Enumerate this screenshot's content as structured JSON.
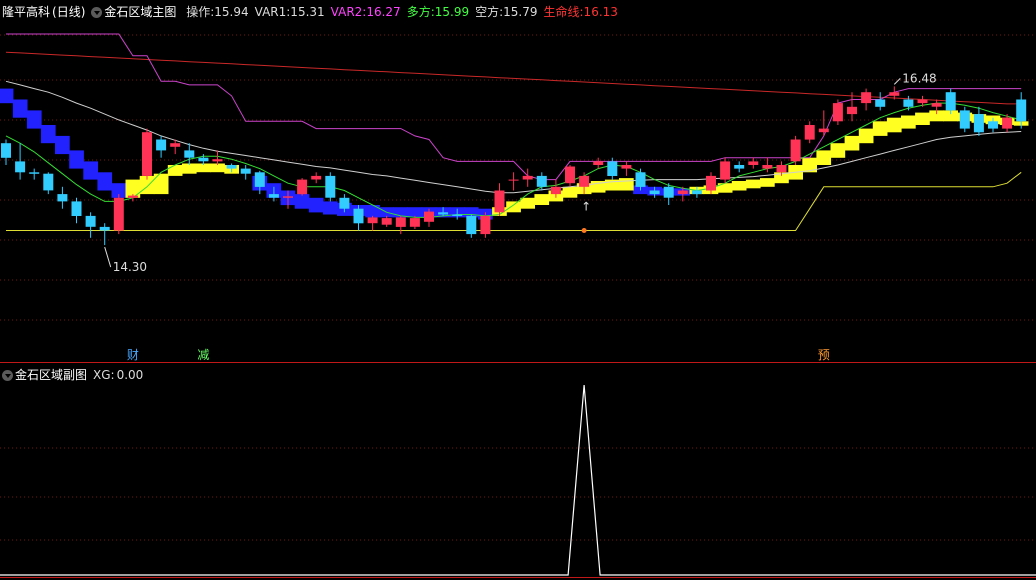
{
  "header": {
    "stock_name": "隆平高科",
    "period": "(日线)",
    "indicator": "金石区域主图",
    "fields": [
      {
        "label": "操作:",
        "value": "15.94",
        "color": "#dcdcdc"
      },
      {
        "label": "VAR1:",
        "value": "15.31",
        "color": "#dcdcdc"
      },
      {
        "label": "VAR2:",
        "value": "16.27",
        "color": "#ff44ff"
      },
      {
        "label": "多方:",
        "value": "15.99",
        "color": "#44ff44"
      },
      {
        "label": "空方:",
        "value": "15.79",
        "color": "#dcdcdc"
      },
      {
        "label": "生命线:",
        "value": "16.13",
        "color": "#ff3333"
      }
    ]
  },
  "sub_header": {
    "indicator": "金石区域副图",
    "label": "XG:",
    "value": "0.00"
  },
  "annotations": {
    "high_label": "16.48",
    "low_label": "14.30",
    "arrow": "↑"
  },
  "signals": [
    {
      "text": "财",
      "bar": 9,
      "color": "#4aa8ff"
    },
    {
      "text": "减",
      "bar": 14,
      "color": "#66ff66"
    },
    {
      "text": "预",
      "bar": 58,
      "color": "#ff9933"
    }
  ],
  "colors": {
    "up": "#ff3355",
    "down": "#33ccff",
    "kong_band": "#2222ff",
    "duo_band": "#ffff22",
    "life_line": "#c82828",
    "var2_line": "#cc44cc",
    "grid": "#7a1414",
    "sub_line": "#ffffff"
  },
  "chart_data": {
    "type": "candlestick",
    "y_range": [
      13.6,
      17.2
    ],
    "ohlc": [
      [
        15.7,
        15.75,
        15.4,
        15.5
      ],
      [
        15.45,
        15.7,
        15.2,
        15.3
      ],
      [
        15.3,
        15.35,
        15.2,
        15.28
      ],
      [
        15.28,
        15.3,
        15.0,
        15.05
      ],
      [
        15.0,
        15.1,
        14.8,
        14.9
      ],
      [
        14.9,
        14.95,
        14.6,
        14.7
      ],
      [
        14.7,
        14.75,
        14.4,
        14.55
      ],
      [
        14.55,
        14.6,
        14.3,
        14.5
      ],
      [
        14.5,
        15.0,
        14.45,
        14.95
      ],
      [
        14.95,
        15.0,
        14.9,
        14.98
      ],
      [
        15.25,
        15.9,
        15.2,
        15.85
      ],
      [
        15.75,
        15.8,
        15.5,
        15.6
      ],
      [
        15.65,
        15.75,
        15.55,
        15.7
      ],
      [
        15.6,
        15.7,
        15.4,
        15.5
      ],
      [
        15.5,
        15.55,
        15.4,
        15.45
      ],
      [
        15.45,
        15.6,
        15.4,
        15.48
      ],
      [
        15.4,
        15.42,
        15.3,
        15.35
      ],
      [
        15.35,
        15.4,
        15.2,
        15.28
      ],
      [
        15.3,
        15.32,
        15.0,
        15.1
      ],
      [
        15.0,
        15.1,
        14.9,
        14.95
      ],
      [
        14.95,
        15.05,
        14.8,
        14.97
      ],
      [
        15.0,
        15.22,
        14.98,
        15.2
      ],
      [
        15.2,
        15.3,
        15.15,
        15.25
      ],
      [
        15.25,
        15.3,
        14.9,
        14.95
      ],
      [
        14.95,
        15.0,
        14.75,
        14.8
      ],
      [
        14.8,
        14.85,
        14.5,
        14.6
      ],
      [
        14.6,
        14.7,
        14.5,
        14.68
      ],
      [
        14.58,
        14.7,
        14.55,
        14.67
      ],
      [
        14.55,
        14.7,
        14.45,
        14.68
      ],
      [
        14.55,
        14.7,
        14.52,
        14.67
      ],
      [
        14.62,
        14.8,
        14.55,
        14.76
      ],
      [
        14.75,
        14.82,
        14.7,
        14.72
      ],
      [
        14.72,
        14.8,
        14.65,
        14.7
      ],
      [
        14.7,
        14.72,
        14.4,
        14.45
      ],
      [
        14.45,
        14.75,
        14.4,
        14.7
      ],
      [
        14.75,
        15.15,
        14.7,
        15.05
      ],
      [
        15.2,
        15.3,
        15.05,
        15.2
      ],
      [
        15.2,
        15.35,
        15.1,
        15.25
      ],
      [
        15.25,
        15.3,
        15.05,
        15.1
      ],
      [
        15.0,
        15.2,
        14.95,
        15.1
      ],
      [
        15.15,
        15.4,
        15.1,
        15.38
      ],
      [
        15.1,
        15.3,
        15.0,
        15.25
      ],
      [
        15.4,
        15.5,
        15.35,
        15.45
      ],
      [
        15.45,
        15.5,
        15.2,
        15.25
      ],
      [
        15.35,
        15.45,
        15.25,
        15.4
      ],
      [
        15.3,
        15.35,
        15.05,
        15.1
      ],
      [
        15.05,
        15.1,
        14.95,
        15.0
      ],
      [
        15.1,
        15.15,
        14.85,
        14.95
      ],
      [
        15.0,
        15.1,
        14.9,
        15.05
      ],
      [
        15.05,
        15.1,
        14.95,
        15.0
      ],
      [
        15.05,
        15.3,
        15.0,
        15.25
      ],
      [
        15.2,
        15.5,
        15.15,
        15.45
      ],
      [
        15.4,
        15.45,
        15.3,
        15.35
      ],
      [
        15.4,
        15.5,
        15.35,
        15.45
      ],
      [
        15.35,
        15.5,
        15.3,
        15.4
      ],
      [
        15.3,
        15.45,
        15.25,
        15.4
      ],
      [
        15.45,
        15.8,
        15.4,
        15.75
      ],
      [
        15.75,
        16.0,
        15.7,
        15.95
      ],
      [
        15.85,
        16.15,
        15.8,
        15.9
      ],
      [
        16.0,
        16.3,
        15.95,
        16.25
      ],
      [
        16.1,
        16.4,
        16.0,
        16.2
      ],
      [
        16.25,
        16.45,
        16.15,
        16.4
      ],
      [
        16.3,
        16.4,
        16.15,
        16.2
      ],
      [
        16.35,
        16.48,
        16.3,
        16.4
      ],
      [
        16.3,
        16.35,
        16.15,
        16.2
      ],
      [
        16.25,
        16.35,
        16.2,
        16.3
      ],
      [
        16.2,
        16.3,
        16.1,
        16.25
      ],
      [
        16.4,
        16.45,
        16.1,
        16.15
      ],
      [
        16.15,
        16.2,
        15.85,
        15.9
      ],
      [
        16.1,
        16.2,
        15.8,
        15.85
      ],
      [
        16.0,
        16.05,
        15.85,
        15.9
      ],
      [
        15.9,
        16.1,
        15.85,
        16.05
      ],
      [
        16.3,
        16.4,
        15.9,
        16.0
      ]
    ],
    "life_line": [
      16.95,
      16.94,
      16.93,
      16.92,
      16.91,
      16.9,
      16.89,
      16.88,
      16.87,
      16.86,
      16.85,
      16.84,
      16.83,
      16.82,
      16.81,
      16.8,
      16.79,
      16.78,
      16.77,
      16.76,
      16.75,
      16.74,
      16.73,
      16.72,
      16.71,
      16.7,
      16.69,
      16.68,
      16.67,
      16.66,
      16.65,
      16.64,
      16.63,
      16.62,
      16.61,
      16.6,
      16.59,
      16.58,
      16.57,
      16.56,
      16.55,
      16.54,
      16.53,
      16.52,
      16.51,
      16.5,
      16.49,
      16.48,
      16.47,
      16.46,
      16.45,
      16.44,
      16.43,
      16.42,
      16.41,
      16.4,
      16.39,
      16.38,
      16.37,
      16.36,
      16.35,
      16.34,
      16.33,
      16.32,
      16.31,
      16.3,
      16.29,
      16.28,
      16.27,
      16.26,
      16.25,
      16.24,
      16.24
    ],
    "var2": [
      17.2,
      17.2,
      17.2,
      17.2,
      17.2,
      17.2,
      17.2,
      17.2,
      17.2,
      16.9,
      16.9,
      16.55,
      16.55,
      16.5,
      16.5,
      16.5,
      16.35,
      16.0,
      16.0,
      16.0,
      16.0,
      16.0,
      15.9,
      15.9,
      15.9,
      15.9,
      15.9,
      15.9,
      15.9,
      15.8,
      15.75,
      15.5,
      15.45,
      15.45,
      15.45,
      15.45,
      15.45,
      15.25,
      15.2,
      15.2,
      15.45,
      15.45,
      15.45,
      15.45,
      15.45,
      15.45,
      15.45,
      15.45,
      15.45,
      15.45,
      15.45,
      15.5,
      15.5,
      15.5,
      15.5,
      15.5,
      15.5,
      15.5,
      15.8,
      16.25,
      16.3,
      16.3,
      16.3,
      16.4,
      16.45,
      16.45,
      16.45,
      16.45,
      16.45,
      16.45,
      16.45,
      16.45,
      16.45
    ],
    "white_line": [
      16.55,
      16.5,
      16.45,
      16.4,
      16.33,
      16.25,
      16.18,
      16.1,
      16.02,
      15.95,
      15.88,
      15.8,
      15.74,
      15.68,
      15.63,
      15.59,
      15.56,
      15.53,
      15.5,
      15.47,
      15.44,
      15.41,
      15.38,
      15.36,
      15.33,
      15.3,
      15.27,
      15.25,
      15.22,
      15.19,
      15.16,
      15.13,
      15.1,
      15.07,
      15.04,
      15.02,
      15.02,
      15.04,
      15.06,
      15.08,
      15.1,
      15.12,
      15.15,
      15.17,
      15.18,
      15.19,
      15.2,
      15.2,
      15.2,
      15.2,
      15.21,
      15.22,
      15.23,
      15.24,
      15.26,
      15.28,
      15.3,
      15.32,
      15.36,
      15.4,
      15.45,
      15.5,
      15.55,
      15.6,
      15.65,
      15.7,
      15.75,
      15.78,
      15.8,
      15.82,
      15.84,
      15.85,
      15.86
    ],
    "green_line": [
      15.8,
      15.7,
      15.58,
      15.43,
      15.28,
      15.13,
      15.0,
      14.9,
      14.9,
      14.95,
      15.1,
      15.3,
      15.4,
      15.48,
      15.52,
      15.52,
      15.48,
      15.42,
      15.35,
      15.25,
      15.15,
      15.1,
      15.1,
      15.1,
      15.05,
      14.95,
      14.85,
      14.75,
      14.7,
      14.68,
      14.68,
      14.7,
      14.72,
      14.72,
      14.7,
      14.72,
      14.85,
      15.0,
      15.1,
      15.12,
      15.18,
      15.25,
      15.35,
      15.4,
      15.38,
      15.3,
      15.2,
      15.12,
      15.08,
      15.05,
      15.08,
      15.15,
      15.25,
      15.3,
      15.35,
      15.38,
      15.45,
      15.55,
      15.65,
      15.75,
      15.85,
      15.95,
      16.05,
      16.12,
      16.18,
      16.22,
      16.25,
      16.25,
      16.22,
      16.18,
      16.12,
      16.07,
      16.02
    ],
    "support_line": [
      14.5,
      14.5,
      14.5,
      14.5,
      14.5,
      14.5,
      14.5,
      14.5,
      14.5,
      14.5,
      14.5,
      14.5,
      14.5,
      14.5,
      14.5,
      14.5,
      14.5,
      14.5,
      14.5,
      14.5,
      14.5,
      14.5,
      14.5,
      14.5,
      14.5,
      14.5,
      14.5,
      14.5,
      14.5,
      14.5,
      14.5,
      14.5,
      14.5,
      14.5,
      14.5,
      14.5,
      14.5,
      14.5,
      14.5,
      14.5,
      14.5,
      14.5,
      14.5,
      14.5,
      14.5,
      14.5,
      14.5,
      14.5,
      14.5,
      14.5,
      14.5,
      14.5,
      14.5,
      14.5,
      14.5,
      14.5,
      14.5,
      14.8,
      15.1,
      15.1,
      15.1,
      15.1,
      15.1,
      15.1,
      15.1,
      15.1,
      15.1,
      15.1,
      15.1,
      15.1,
      15.1,
      15.15,
      15.3
    ],
    "kong_band": [
      [
        0,
        16.25,
        16.45
      ],
      [
        1,
        16.05,
        16.3
      ],
      [
        2,
        15.9,
        16.15
      ],
      [
        3,
        15.7,
        15.95
      ],
      [
        4,
        15.55,
        15.8
      ],
      [
        5,
        15.35,
        15.6
      ],
      [
        6,
        15.2,
        15.45
      ],
      [
        7,
        15.05,
        15.3
      ],
      [
        8,
        14.95,
        15.15
      ],
      [
        18,
        15.05,
        15.25
      ],
      [
        19,
        14.95,
        15.15
      ],
      [
        20,
        14.85,
        15.05
      ],
      [
        21,
        14.8,
        15.0
      ],
      [
        22,
        14.75,
        14.95
      ],
      [
        23,
        14.72,
        14.9
      ],
      [
        24,
        14.7,
        14.88
      ],
      [
        25,
        14.7,
        14.85
      ],
      [
        26,
        14.68,
        14.85
      ],
      [
        27,
        14.68,
        14.82
      ],
      [
        28,
        14.68,
        14.82
      ],
      [
        29,
        14.68,
        14.82
      ],
      [
        30,
        14.68,
        14.82
      ],
      [
        31,
        14.68,
        14.82
      ],
      [
        32,
        14.68,
        14.82
      ],
      [
        33,
        14.68,
        14.82
      ],
      [
        34,
        14.65,
        14.8
      ],
      [
        45,
        15.0,
        15.12
      ],
      [
        46,
        14.98,
        15.1
      ],
      [
        47,
        14.98,
        15.08
      ],
      [
        48,
        14.98,
        15.08
      ]
    ],
    "duo_band": [
      [
        9,
        14.95,
        15.2
      ],
      [
        10,
        15.0,
        15.25
      ],
      [
        11,
        15.0,
        15.28
      ],
      [
        12,
        15.25,
        15.4
      ],
      [
        13,
        15.28,
        15.42
      ],
      [
        14,
        15.3,
        15.42
      ],
      [
        15,
        15.3,
        15.42
      ],
      [
        16,
        15.28,
        15.4
      ],
      [
        35,
        14.7,
        14.82
      ],
      [
        36,
        14.75,
        14.9
      ],
      [
        37,
        14.8,
        14.95
      ],
      [
        38,
        14.85,
        15.0
      ],
      [
        39,
        14.9,
        15.05
      ],
      [
        40,
        14.95,
        15.1
      ],
      [
        41,
        15.0,
        15.15
      ],
      [
        42,
        15.02,
        15.18
      ],
      [
        43,
        15.05,
        15.2
      ],
      [
        44,
        15.05,
        15.22
      ],
      [
        49,
        15.0,
        15.1
      ],
      [
        50,
        15.0,
        15.12
      ],
      [
        51,
        15.02,
        15.15
      ],
      [
        52,
        15.05,
        15.18
      ],
      [
        53,
        15.08,
        15.2
      ],
      [
        54,
        15.1,
        15.22
      ],
      [
        55,
        15.15,
        15.3
      ],
      [
        56,
        15.2,
        15.4
      ],
      [
        57,
        15.3,
        15.5
      ],
      [
        58,
        15.4,
        15.6
      ],
      [
        59,
        15.5,
        15.7
      ],
      [
        60,
        15.6,
        15.8
      ],
      [
        61,
        15.7,
        15.9
      ],
      [
        62,
        15.8,
        16.0
      ],
      [
        63,
        15.85,
        16.05
      ],
      [
        64,
        15.9,
        16.08
      ],
      [
        65,
        15.95,
        16.12
      ],
      [
        66,
        16.0,
        16.15
      ],
      [
        67,
        16.0,
        16.15
      ],
      [
        68,
        16.0,
        16.12
      ],
      [
        69,
        15.98,
        16.1
      ],
      [
        70,
        15.96,
        16.08
      ],
      [
        71,
        15.95,
        16.05
      ],
      [
        72,
        15.94,
        16.0
      ]
    ],
    "sub_xg": {
      "peak_bar": 41,
      "peak_value": 1,
      "base_value": 0
    }
  }
}
